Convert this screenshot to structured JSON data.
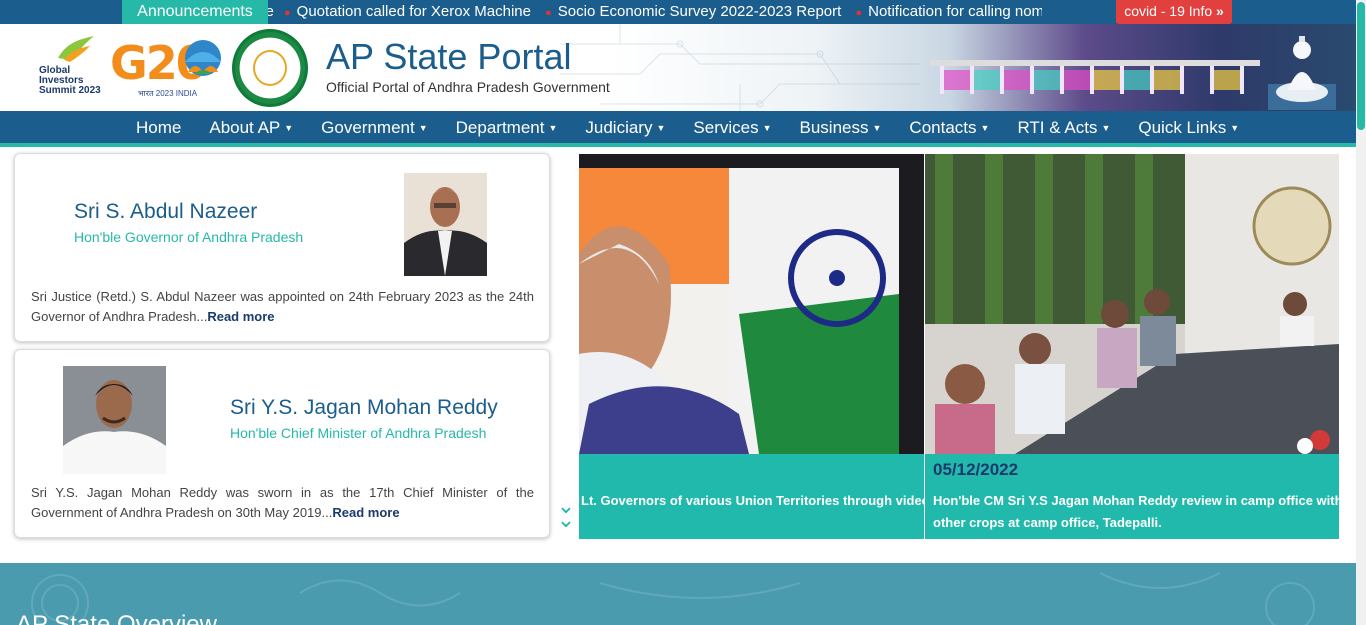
{
  "ticker": {
    "tab_label": "Announcements",
    "prefix": "ce",
    "items": [
      "Quotation called for Xerox Machine",
      "Socio Economic Survey 2022-2023 Report",
      "Notification for calling nominatior"
    ],
    "covid_label": "covid - 19 Info"
  },
  "header": {
    "gis_title": "Global Investors Summit 2023",
    "g20_label": "G20",
    "g20_sub": "भारत 2023 INDIA",
    "site_title": "AP State Portal",
    "site_subtitle": "Official Portal of Andhra Pradesh Government"
  },
  "nav": {
    "items": [
      {
        "label": "Home",
        "has_caret": false
      },
      {
        "label": "About AP",
        "has_caret": true
      },
      {
        "label": "Government",
        "has_caret": true
      },
      {
        "label": "Department",
        "has_caret": true
      },
      {
        "label": "Judiciary",
        "has_caret": true
      },
      {
        "label": "Services",
        "has_caret": true
      },
      {
        "label": "Business",
        "has_caret": true
      },
      {
        "label": "Contacts",
        "has_caret": true
      },
      {
        "label": "RTI & Acts",
        "has_caret": true
      },
      {
        "label": "Quick Links",
        "has_caret": true
      }
    ]
  },
  "governor": {
    "name": "Sri S. Abdul Nazeer",
    "role": "Hon'ble Governor of Andhra Pradesh",
    "description": "Sri Justice (Retd.) S. Abdul Nazeer was appointed on 24th February 2023 as the 24th Governor of Andhra Pradesh...",
    "read_more": "Read more"
  },
  "chief_minister": {
    "name": "Sri Y.S. Jagan Mohan Reddy",
    "role": "Hon'ble Chief Minister of Andhra Pradesh",
    "description": "Sri Y.S. Jagan Mohan Reddy was sworn in as the 17th Chief Minister of the Government of Andhra Pradesh on 30th May 2019...",
    "read_more": "Read more"
  },
  "slides": [
    {
      "date": "",
      "caption": "Lt. Governors of various Union Territories through video"
    },
    {
      "date": "05/12/2022",
      "caption_line1": "Hon'ble CM Sri Y.S Jagan Mohan Reddy review in camp office with agriculture and",
      "caption_line2": "other crops at camp office, Tadepalli."
    }
  ],
  "overview": {
    "title": "AP State Overview"
  },
  "colors": {
    "primary": "#1b5d8c",
    "accent": "#26b9a8",
    "alert": "#e2403f"
  }
}
